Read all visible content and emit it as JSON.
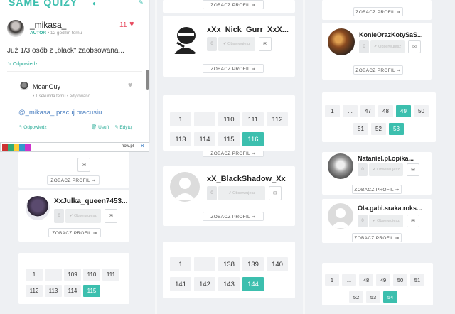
{
  "logo": "SAME QUIZY",
  "comments": {
    "main": {
      "author": "_mikasa_",
      "role": "AUTOR",
      "time": "• 12 godzin temu",
      "likes": "11",
      "text": "Już 1/3 osób z „black\" zaobsowana...",
      "reply_label": "Odpowiedz",
      "more": "···"
    },
    "reply": {
      "author": "MeanGuy",
      "time": "• 1 sekunda temu • edytowano",
      "mention": "@_mikasa_",
      "text": "pracuj pracusiu",
      "reply_label": "Odpowiedz",
      "delete_label": "Usuń",
      "edit_label": "Edytuj"
    }
  },
  "ad": {
    "label": "now.pl",
    "close": "✕"
  },
  "profile_button": "ZOBACZ PROFIL ➞",
  "follow_label": "✔ Obserwujesz",
  "users": {
    "col1_a": "XxJulka_queen7453...",
    "col2_a": "xXx_Nick_Gurr_XxX...",
    "col2_b": "xX_BlackShadow_Xx",
    "col3_a": "KonieOrazKotySaS...",
    "col3_b": "Nataniel.pl.opika...",
    "col3_c": "Ola.gabi.sraka.roks..."
  },
  "pagination": {
    "col1": {
      "row1": [
        "1",
        "...",
        "109",
        "110",
        "111"
      ],
      "row2": [
        "112",
        "113",
        "114",
        "115"
      ],
      "active": "115"
    },
    "col2_top": {
      "row1": [
        "1",
        "...",
        "110",
        "111",
        "112"
      ],
      "row2": [
        "113",
        "114",
        "115",
        "116"
      ],
      "active": "116"
    },
    "col2_bottom": {
      "row1": [
        "1",
        "...",
        "138",
        "139",
        "140"
      ],
      "row2": [
        "141",
        "142",
        "143",
        "144"
      ],
      "active": "144"
    },
    "col3_top": {
      "row1": [
        "1",
        "...",
        "47",
        "48",
        "49",
        "50"
      ],
      "row2": [
        "51",
        "52",
        "53"
      ],
      "active_row1": "49",
      "active": "53"
    },
    "col3_bottom": {
      "row1": [
        "1",
        "...",
        "48",
        "49",
        "50",
        "51"
      ],
      "row2": [
        "52",
        "53",
        "54"
      ],
      "active": "54"
    }
  },
  "colors": {
    "accent": "#3cbfae",
    "heart": "#e84a5f"
  }
}
